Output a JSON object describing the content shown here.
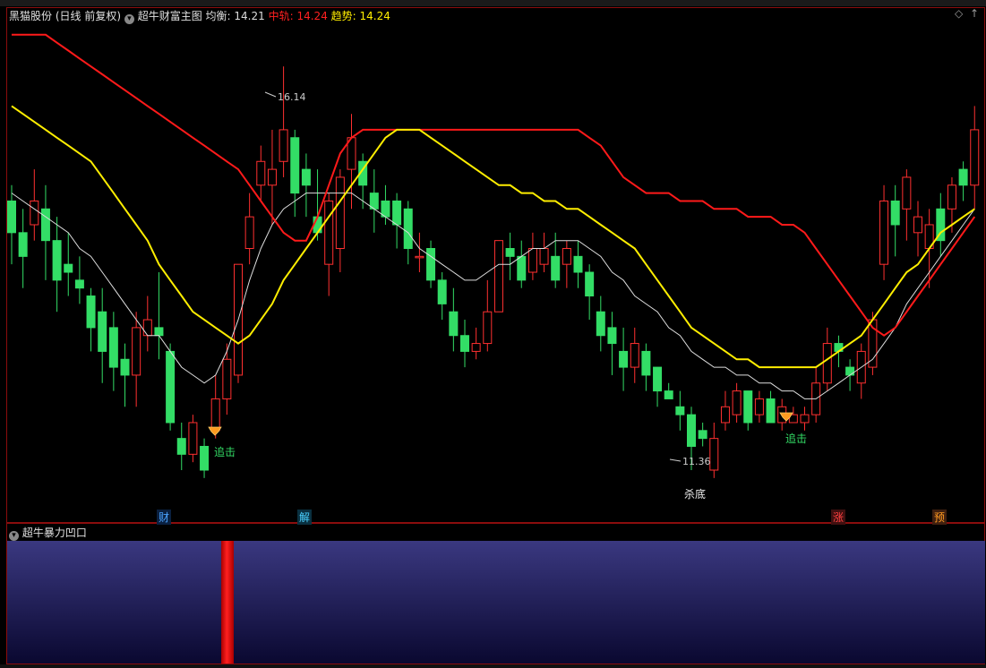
{
  "stock": {
    "name": "黑猫股份",
    "period": "(日线 前复权)"
  },
  "indicator_main": {
    "name": "超牛财富主图",
    "items": [
      {
        "label": "均衡:",
        "value": "14.21",
        "color": "#dddddd"
      },
      {
        "label": "中轨:",
        "value": "14.24",
        "color": "#ff2020"
      },
      {
        "label": "趋势:",
        "value": "14.24",
        "color": "#ffff00"
      }
    ]
  },
  "indicator_sub": {
    "name": "超牛暴力凹口"
  },
  "annotations": {
    "high_price": "16.14",
    "low_price": "11.36",
    "chase_signal_1": "追击",
    "chase_signal_2": "追击",
    "bottom_label": "杀底"
  },
  "event_tags": [
    {
      "text": "财",
      "color": "#4aa3ff"
    },
    {
      "text": "解",
      "color": "#4ad0ff"
    },
    {
      "text": "涨",
      "color": "#ff4040"
    },
    {
      "text": "预",
      "color": "#ff9a20"
    }
  ],
  "colors": {
    "up": "#ff3030",
    "down": "#33dd66",
    "ma_white": "#dddddd",
    "mid_red": "#ff1a1a",
    "trend_yellow": "#ffee00"
  },
  "chart_data": {
    "type": "candlestick",
    "y_range": [
      11.0,
      16.6
    ],
    "candles": [
      [
        14.4,
        14.0,
        14.6,
        13.6
      ],
      [
        14.0,
        13.7,
        14.3,
        13.3
      ],
      [
        14.1,
        14.4,
        14.8,
        13.9
      ],
      [
        14.3,
        13.9,
        14.6,
        13.4
      ],
      [
        13.9,
        13.4,
        14.2,
        13.0
      ],
      [
        13.6,
        13.5,
        14.0,
        13.2
      ],
      [
        13.4,
        13.3,
        13.7,
        13.1
      ],
      [
        13.2,
        12.8,
        13.3,
        12.5
      ],
      [
        13.0,
        12.5,
        13.3,
        12.1
      ],
      [
        12.8,
        12.3,
        13.0,
        12.0
      ],
      [
        12.4,
        12.2,
        12.6,
        11.8
      ],
      [
        12.2,
        12.8,
        13.0,
        11.8
      ],
      [
        12.7,
        12.9,
        13.2,
        12.5
      ],
      [
        12.8,
        12.7,
        13.5,
        12.4
      ],
      [
        12.5,
        11.6,
        12.6,
        11.5
      ],
      [
        11.4,
        11.2,
        11.6,
        11.0
      ],
      [
        11.2,
        11.6,
        11.7,
        11.1
      ],
      [
        11.3,
        11.0,
        11.4,
        10.9
      ],
      [
        11.5,
        11.9,
        12.2,
        11.4
      ],
      [
        11.9,
        12.4,
        12.6,
        11.7
      ],
      [
        12.2,
        13.6,
        13.6,
        12.1
      ],
      [
        13.8,
        14.2,
        14.5,
        13.6
      ],
      [
        14.6,
        14.9,
        15.1,
        14.4
      ],
      [
        14.6,
        14.8,
        15.3,
        14.1
      ],
      [
        14.9,
        15.3,
        16.1,
        14.7
      ],
      [
        15.2,
        14.5,
        15.3,
        14.2
      ],
      [
        14.8,
        14.6,
        15.0,
        14.2
      ],
      [
        14.2,
        14.0,
        14.8,
        13.9
      ],
      [
        13.6,
        14.4,
        14.5,
        13.2
      ],
      [
        13.8,
        14.7,
        14.8,
        13.5
      ],
      [
        14.8,
        15.2,
        15.5,
        14.3
      ],
      [
        14.9,
        14.6,
        15.0,
        14.3
      ],
      [
        14.5,
        14.3,
        14.8,
        14.0
      ],
      [
        14.4,
        14.2,
        14.6,
        14.1
      ],
      [
        14.4,
        14.1,
        14.5,
        13.8
      ],
      [
        14.3,
        13.8,
        14.4,
        13.6
      ],
      [
        13.7,
        13.7,
        14.0,
        13.5
      ],
      [
        13.8,
        13.4,
        13.9,
        13.3
      ],
      [
        13.4,
        13.1,
        13.5,
        12.9
      ],
      [
        13.0,
        12.7,
        13.3,
        12.5
      ],
      [
        12.7,
        12.5,
        12.9,
        12.3
      ],
      [
        12.5,
        12.6,
        12.8,
        12.4
      ],
      [
        12.6,
        13.0,
        13.4,
        12.5
      ],
      [
        13.0,
        13.9,
        13.9,
        13.0
      ],
      [
        13.8,
        13.7,
        14.0,
        13.4
      ],
      [
        13.7,
        13.4,
        13.9,
        13.3
      ],
      [
        13.5,
        13.8,
        14.0,
        13.4
      ],
      [
        13.6,
        13.8,
        14.0,
        13.5
      ],
      [
        13.7,
        13.4,
        14.0,
        13.3
      ],
      [
        13.6,
        13.8,
        13.9,
        13.3
      ],
      [
        13.7,
        13.5,
        13.9,
        13.3
      ],
      [
        13.5,
        13.2,
        13.6,
        12.9
      ],
      [
        13.0,
        12.7,
        13.2,
        12.5
      ],
      [
        12.8,
        12.6,
        13.0,
        12.2
      ],
      [
        12.5,
        12.3,
        12.8,
        12.0
      ],
      [
        12.3,
        12.6,
        12.8,
        12.1
      ],
      [
        12.5,
        12.2,
        12.6,
        12.0
      ],
      [
        12.3,
        12.0,
        12.3,
        11.8
      ],
      [
        12.0,
        11.9,
        12.1,
        11.9
      ],
      [
        11.8,
        11.7,
        12.0,
        11.5
      ],
      [
        11.7,
        11.3,
        11.8,
        11.0
      ],
      [
        11.5,
        11.4,
        11.6,
        11.3
      ],
      [
        11.0,
        11.4,
        11.6,
        10.9
      ],
      [
        11.6,
        11.8,
        12.0,
        11.5
      ],
      [
        11.7,
        12.0,
        12.1,
        11.6
      ],
      [
        12.0,
        11.6,
        12.0,
        11.5
      ],
      [
        11.7,
        11.9,
        12.0,
        11.6
      ],
      [
        11.9,
        11.6,
        12.0,
        11.6
      ],
      [
        11.6,
        11.8,
        11.9,
        11.5
      ],
      [
        11.6,
        11.7,
        11.8,
        11.6
      ],
      [
        11.6,
        11.7,
        11.8,
        11.5
      ],
      [
        11.7,
        12.1,
        12.3,
        11.6
      ],
      [
        12.1,
        12.6,
        12.8,
        12.0
      ],
      [
        12.6,
        12.5,
        12.7,
        12.3
      ],
      [
        12.3,
        12.2,
        12.4,
        12.0
      ],
      [
        12.1,
        12.5,
        12.6,
        11.9
      ],
      [
        12.3,
        12.9,
        13.0,
        12.2
      ],
      [
        13.6,
        14.4,
        14.6,
        13.4
      ],
      [
        14.4,
        14.1,
        14.6,
        13.7
      ],
      [
        14.3,
        14.7,
        14.8,
        13.9
      ],
      [
        14.0,
        14.2,
        14.4,
        13.7
      ],
      [
        13.8,
        14.1,
        14.3,
        13.3
      ],
      [
        14.3,
        13.9,
        14.5,
        13.7
      ],
      [
        14.3,
        14.6,
        14.7,
        14.0
      ],
      [
        14.8,
        14.6,
        14.9,
        14.4
      ],
      [
        14.6,
        15.3,
        15.6,
        14.3
      ]
    ],
    "series": [
      {
        "name": "均衡",
        "color": "#dddddd",
        "values": [
          14.5,
          14.4,
          14.3,
          14.2,
          14.1,
          14.0,
          13.8,
          13.7,
          13.5,
          13.3,
          13.1,
          12.9,
          12.7,
          12.7,
          12.5,
          12.3,
          12.2,
          12.1,
          12.2,
          12.5,
          12.9,
          13.4,
          13.8,
          14.1,
          14.3,
          14.4,
          14.5,
          14.5,
          14.5,
          14.5,
          14.5,
          14.4,
          14.3,
          14.2,
          14.1,
          14.0,
          13.8,
          13.7,
          13.6,
          13.5,
          13.4,
          13.4,
          13.5,
          13.6,
          13.6,
          13.7,
          13.8,
          13.8,
          13.9,
          13.9,
          13.9,
          13.8,
          13.7,
          13.5,
          13.4,
          13.2,
          13.1,
          13.0,
          12.8,
          12.7,
          12.5,
          12.4,
          12.3,
          12.3,
          12.2,
          12.2,
          12.1,
          12.1,
          12.0,
          12.0,
          11.9,
          11.9,
          12.0,
          12.1,
          12.2,
          12.3,
          12.4,
          12.6,
          12.8,
          13.1,
          13.3,
          13.5,
          13.7,
          13.9,
          14.1,
          14.3
        ]
      },
      {
        "name": "中轨",
        "color": "#ff1a1a",
        "values": [
          16.5,
          16.5,
          16.5,
          16.5,
          16.4,
          16.3,
          16.2,
          16.1,
          16.0,
          15.9,
          15.8,
          15.7,
          15.6,
          15.5,
          15.4,
          15.3,
          15.2,
          15.1,
          15.0,
          14.9,
          14.8,
          14.6,
          14.4,
          14.2,
          14.0,
          13.9,
          13.9,
          14.2,
          14.6,
          15.0,
          15.2,
          15.3,
          15.3,
          15.3,
          15.3,
          15.3,
          15.3,
          15.3,
          15.3,
          15.3,
          15.3,
          15.3,
          15.3,
          15.3,
          15.3,
          15.3,
          15.3,
          15.3,
          15.3,
          15.3,
          15.3,
          15.2,
          15.1,
          14.9,
          14.7,
          14.6,
          14.5,
          14.5,
          14.5,
          14.4,
          14.4,
          14.4,
          14.3,
          14.3,
          14.3,
          14.2,
          14.2,
          14.2,
          14.1,
          14.1,
          14.0,
          13.8,
          13.6,
          13.4,
          13.2,
          13.0,
          12.8,
          12.7,
          12.8,
          13.0,
          13.2,
          13.4,
          13.6,
          13.8,
          14.0,
          14.2
        ]
      },
      {
        "name": "趋势",
        "color": "#ffee00",
        "values": [
          15.6,
          15.5,
          15.4,
          15.3,
          15.2,
          15.1,
          15.0,
          14.9,
          14.7,
          14.5,
          14.3,
          14.1,
          13.9,
          13.6,
          13.4,
          13.2,
          13.0,
          12.9,
          12.8,
          12.7,
          12.6,
          12.7,
          12.9,
          13.1,
          13.4,
          13.6,
          13.8,
          14.0,
          14.2,
          14.4,
          14.6,
          14.8,
          15.0,
          15.2,
          15.3,
          15.3,
          15.3,
          15.2,
          15.1,
          15.0,
          14.9,
          14.8,
          14.7,
          14.6,
          14.6,
          14.5,
          14.5,
          14.4,
          14.4,
          14.3,
          14.3,
          14.2,
          14.1,
          14.0,
          13.9,
          13.8,
          13.6,
          13.4,
          13.2,
          13.0,
          12.8,
          12.7,
          12.6,
          12.5,
          12.4,
          12.4,
          12.3,
          12.3,
          12.3,
          12.3,
          12.3,
          12.3,
          12.4,
          12.5,
          12.6,
          12.7,
          12.9,
          13.1,
          13.3,
          13.5,
          13.6,
          13.8,
          14.0,
          14.1,
          14.2,
          14.3
        ]
      }
    ]
  }
}
